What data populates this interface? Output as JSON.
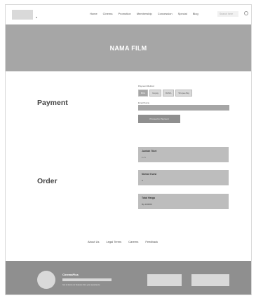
{
  "nav": {
    "links": [
      "Home",
      "Cinema",
      "Promotion",
      "Membership",
      "Concession",
      "Special",
      "Blog"
    ],
    "search_placeholder": "Search here"
  },
  "hero": {
    "title": "NAMA FILM"
  },
  "payment": {
    "title": "Payment",
    "method_label": "Payment Method",
    "methods": [
      "BCA",
      "Gopay",
      "DANA",
      "ShopeePay"
    ],
    "email_label": "Email Kamu",
    "email_value": "",
    "button_label": "Proceed to Payment"
  },
  "order": {
    "title": "Order",
    "cards": [
      {
        "label": "Jumlah Tiket",
        "value": "1  /  1"
      },
      {
        "label": "Nomor Kursi",
        "value": "A"
      },
      {
        "label": "Total Harga",
        "value": "Rp.100000"
      }
    ]
  },
  "footer_links": [
    "About Us",
    "Legal Terms",
    "Careers",
    "Feedback"
  ],
  "footer": {
    "brand": "CinemaPlus",
    "description": "Get to know our features from your experience"
  }
}
